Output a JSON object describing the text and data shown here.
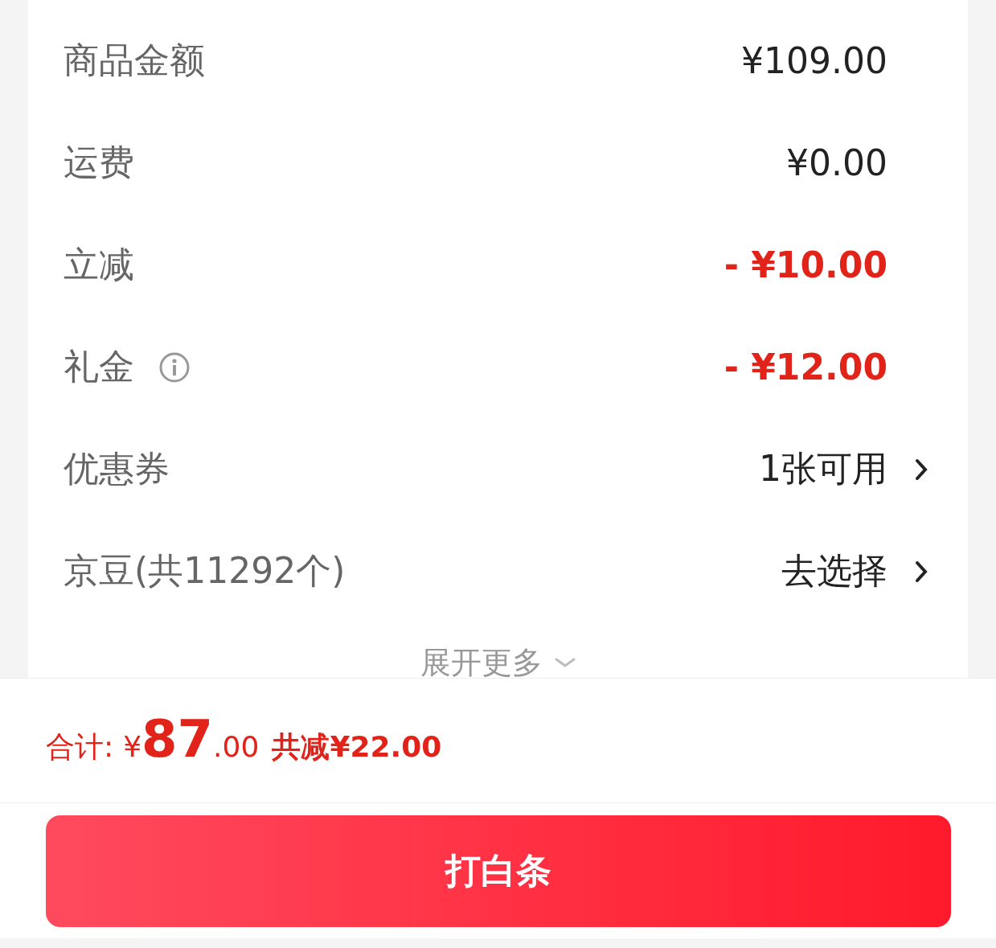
{
  "summary": {
    "rows": [
      {
        "label": "商品金额",
        "value": "¥109.00",
        "kind": "amount"
      },
      {
        "label": "运费",
        "value": "¥0.00",
        "kind": "amount"
      },
      {
        "label": "立减",
        "value": "- ¥10.00",
        "kind": "discount"
      },
      {
        "label": "礼金",
        "value": "- ¥12.00",
        "kind": "discount",
        "info": true
      },
      {
        "label": "优惠券",
        "value": "1张可用",
        "kind": "link"
      },
      {
        "label": "京豆(共11292个)",
        "value": "去选择",
        "kind": "link"
      }
    ],
    "expand": "展开更多"
  },
  "total": {
    "label": "合计:",
    "currency": "¥",
    "integer": "87",
    "decimal": ".00",
    "saved": "共减¥22.00"
  },
  "button": "打白条"
}
